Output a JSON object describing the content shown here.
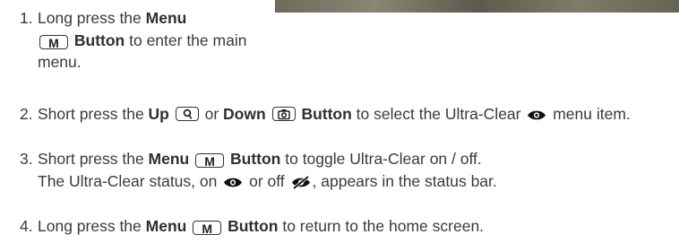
{
  "page": {
    "photo_icon": "photo-thumbnail"
  },
  "steps": [
    {
      "num": "1.",
      "a": "Long press the ",
      "b1": "Menu",
      "key1": "M",
      "b2": "Button",
      "c": " to enter the main menu."
    },
    {
      "num": "2.",
      "a": "Short press the ",
      "up": "Up",
      "up_icon": "magnifier-icon",
      "or": " or ",
      "down": "Down",
      "down_icon": "camera-icon",
      "btn": "Button",
      "c": " to select the Ultra-Clear ",
      "icon": "eye-icon",
      "d": " menu item."
    },
    {
      "num": "3.",
      "a": "Short press the ",
      "b1": "Menu",
      "key1": "M",
      "b2": "Button",
      "c": " to toggle Ultra-Clear on / off.",
      "d": "The Ultra-Clear status, on ",
      "on_icon": "eye-icon",
      "e": " or off ",
      "off_icon": "eye-off-icon",
      "f": ", appears in the status bar."
    },
    {
      "num": "4.",
      "a": "Long press the ",
      "b1": "Menu",
      "key1": "M",
      "b2": "Button",
      "c": " to return to the home screen."
    }
  ]
}
